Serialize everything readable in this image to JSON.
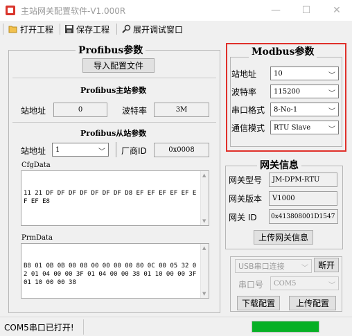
{
  "window": {
    "title": "主站网关配置软件-V1.000R",
    "minimize": "—",
    "maximize": "☐",
    "close": "✕"
  },
  "toolbar": {
    "open_project": "打开工程",
    "save_project": "保存工程",
    "debug_window": "展开调试窗口"
  },
  "profibus": {
    "title": "Profibus参数",
    "import_button": "导入配置文件",
    "master_title": "Profibus主站参数",
    "master_address_label": "站地址",
    "master_address_value": "0",
    "baud_label": "波特率",
    "baud_value": "3M",
    "slave_title": "Profibus从站参数",
    "slave_address_label": "站地址",
    "slave_address_value": "1",
    "vendor_id_label": "厂商ID",
    "vendor_id_value": "0x0008",
    "cfgdata_label": "CfgData",
    "cfgdata_value": "11 21 DF DF DF DF DF DF DF D8 EF EF EF EF EF EF EF E8",
    "prmdata_label": "PrmData",
    "prmdata_value": "B8 01 0B 0B 00 08 00 00 00 00 80 0C 00 05 32 02 01 04 00 00 3F 01 04 00 00 38 01 10 00 00 3F 01 10 00 00 38"
  },
  "modbus": {
    "title": "Modbus参数",
    "address_label": "站地址",
    "address_value": "10",
    "baud_label": "波特率",
    "baud_value": "115200",
    "serial_format_label": "串口格式",
    "serial_format_value": "8-No-1",
    "mode_label": "通信模式",
    "mode_value": "RTU Slave",
    "highlight_color": "#e0302a"
  },
  "gateway": {
    "title": "网关信息",
    "model_label": "网关型号",
    "model_value": "JM-DPM-RTU",
    "version_label": "网关版本",
    "version_value": "V1000",
    "id_label": "网关 ID",
    "id_value": "0x413808001D1547",
    "upload_info_button": "上传网关信息"
  },
  "connection": {
    "type_value": "USB串口连接",
    "disconnect_button": "断开",
    "port_label": "串口号",
    "port_value": "COM5",
    "download_button": "下载配置",
    "upload_button": "上传配置"
  },
  "status": {
    "text": "COM5串口已打开!",
    "indicator_color": "#06b025"
  }
}
